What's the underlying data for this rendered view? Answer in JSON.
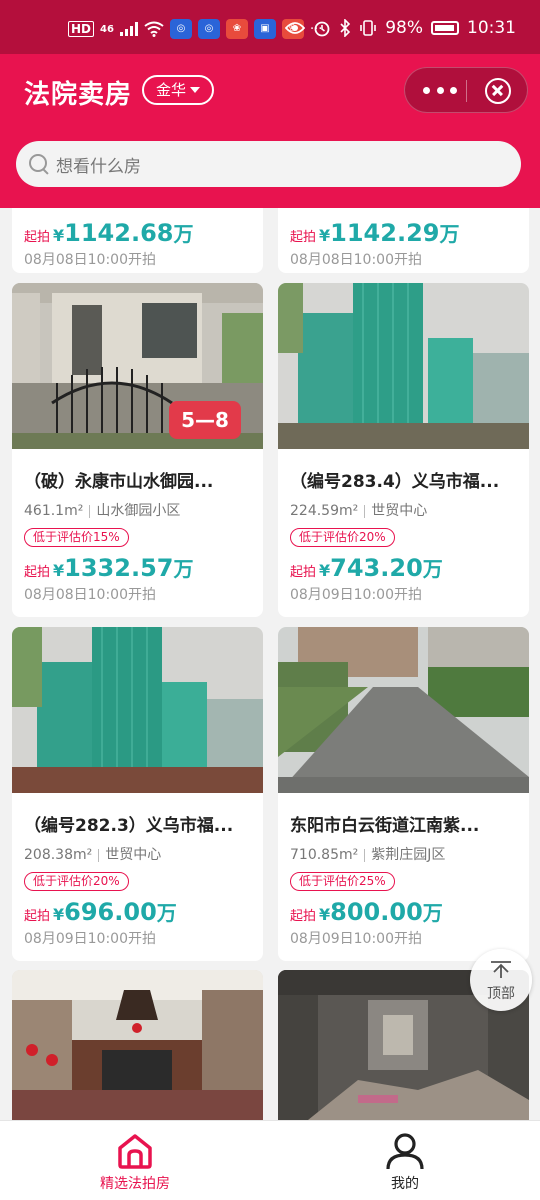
{
  "status": {
    "left_badges": [
      "HD",
      "46"
    ],
    "battery": "98%",
    "time": "10:31",
    "more": "···"
  },
  "header": {
    "title": "法院卖房",
    "city": "金华",
    "search_placeholder": "想看什么房"
  },
  "cards": [
    {
      "price_label": "起拍",
      "currency": "¥",
      "price": "1142.68",
      "unit": "万",
      "time": "08月08日10:00开拍"
    },
    {
      "price_label": "起拍",
      "currency": "¥",
      "price": "1142.29",
      "unit": "万",
      "time": "08月08日10:00开拍"
    },
    {
      "title": "（破）永康市山水御园...",
      "area": "461.1m²",
      "community": "山水御园小区",
      "tag": "低于评估价15%",
      "price_label": "起拍",
      "currency": "¥",
      "price": "1332.57",
      "unit": "万",
      "time": "08月08日10:00开拍",
      "photo_badge": "5—8"
    },
    {
      "title": "（编号283.4）义乌市福...",
      "area": "224.59m²",
      "community": "世贸中心",
      "tag": "低于评估价20%",
      "price_label": "起拍",
      "currency": "¥",
      "price": "743.20",
      "unit": "万",
      "time": "08月09日10:00开拍"
    },
    {
      "title": "（编号282.3）义乌市福...",
      "area": "208.38m²",
      "community": "世贸中心",
      "tag": "低于评估价20%",
      "price_label": "起拍",
      "currency": "¥",
      "price": "696.00",
      "unit": "万",
      "time": "08月09日10:00开拍"
    },
    {
      "title": "东阳市白云街道江南紫...",
      "area": "710.85m²",
      "community": "紫荆庄园J区",
      "tag": "低于评估价25%",
      "price_label": "起拍",
      "currency": "¥",
      "price": "800.00",
      "unit": "万",
      "time": "08月09日10:00开拍"
    }
  ],
  "back_to_top": "顶部",
  "tabs": [
    {
      "label": "精选法拍房",
      "icon": "home-icon",
      "active": true
    },
    {
      "label": "我的",
      "icon": "user-icon",
      "active": false
    }
  ],
  "colors": {
    "brand": "#e8134f",
    "price": "#1fa9a8",
    "status_bar": "#b40f3c"
  }
}
